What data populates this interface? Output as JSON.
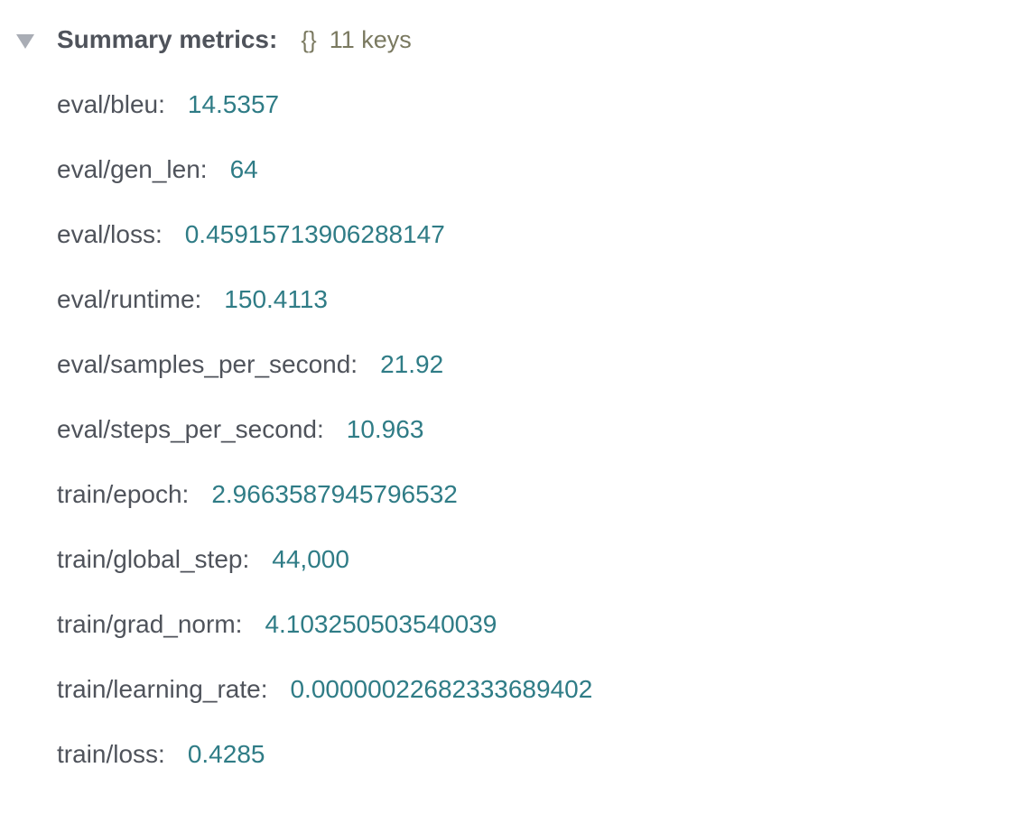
{
  "summary": {
    "title": "Summary metrics:",
    "type_glyph": "{}",
    "count_label": "11 keys",
    "toggle_icon": "caret-down-icon",
    "metrics": [
      {
        "key": "eval/bleu:",
        "value": "14.5357"
      },
      {
        "key": "eval/gen_len:",
        "value": "64"
      },
      {
        "key": "eval/loss:",
        "value": "0.45915713906288147"
      },
      {
        "key": "eval/runtime:",
        "value": "150.4113"
      },
      {
        "key": "eval/samples_per_second:",
        "value": "21.92"
      },
      {
        "key": "eval/steps_per_second:",
        "value": "10.963"
      },
      {
        "key": "train/epoch:",
        "value": "2.9663587945796532"
      },
      {
        "key": "train/global_step:",
        "value": "44,000"
      },
      {
        "key": "train/grad_norm:",
        "value": "4.103250503540039"
      },
      {
        "key": "train/learning_rate:",
        "value": "0.00000022682333689402"
      },
      {
        "key": "train/loss:",
        "value": "0.4285"
      }
    ]
  },
  "colors": {
    "key_text": "#4f535b",
    "value_text": "#2f7c86",
    "meta_text": "#7a7960",
    "caret": "#a9adb5"
  }
}
